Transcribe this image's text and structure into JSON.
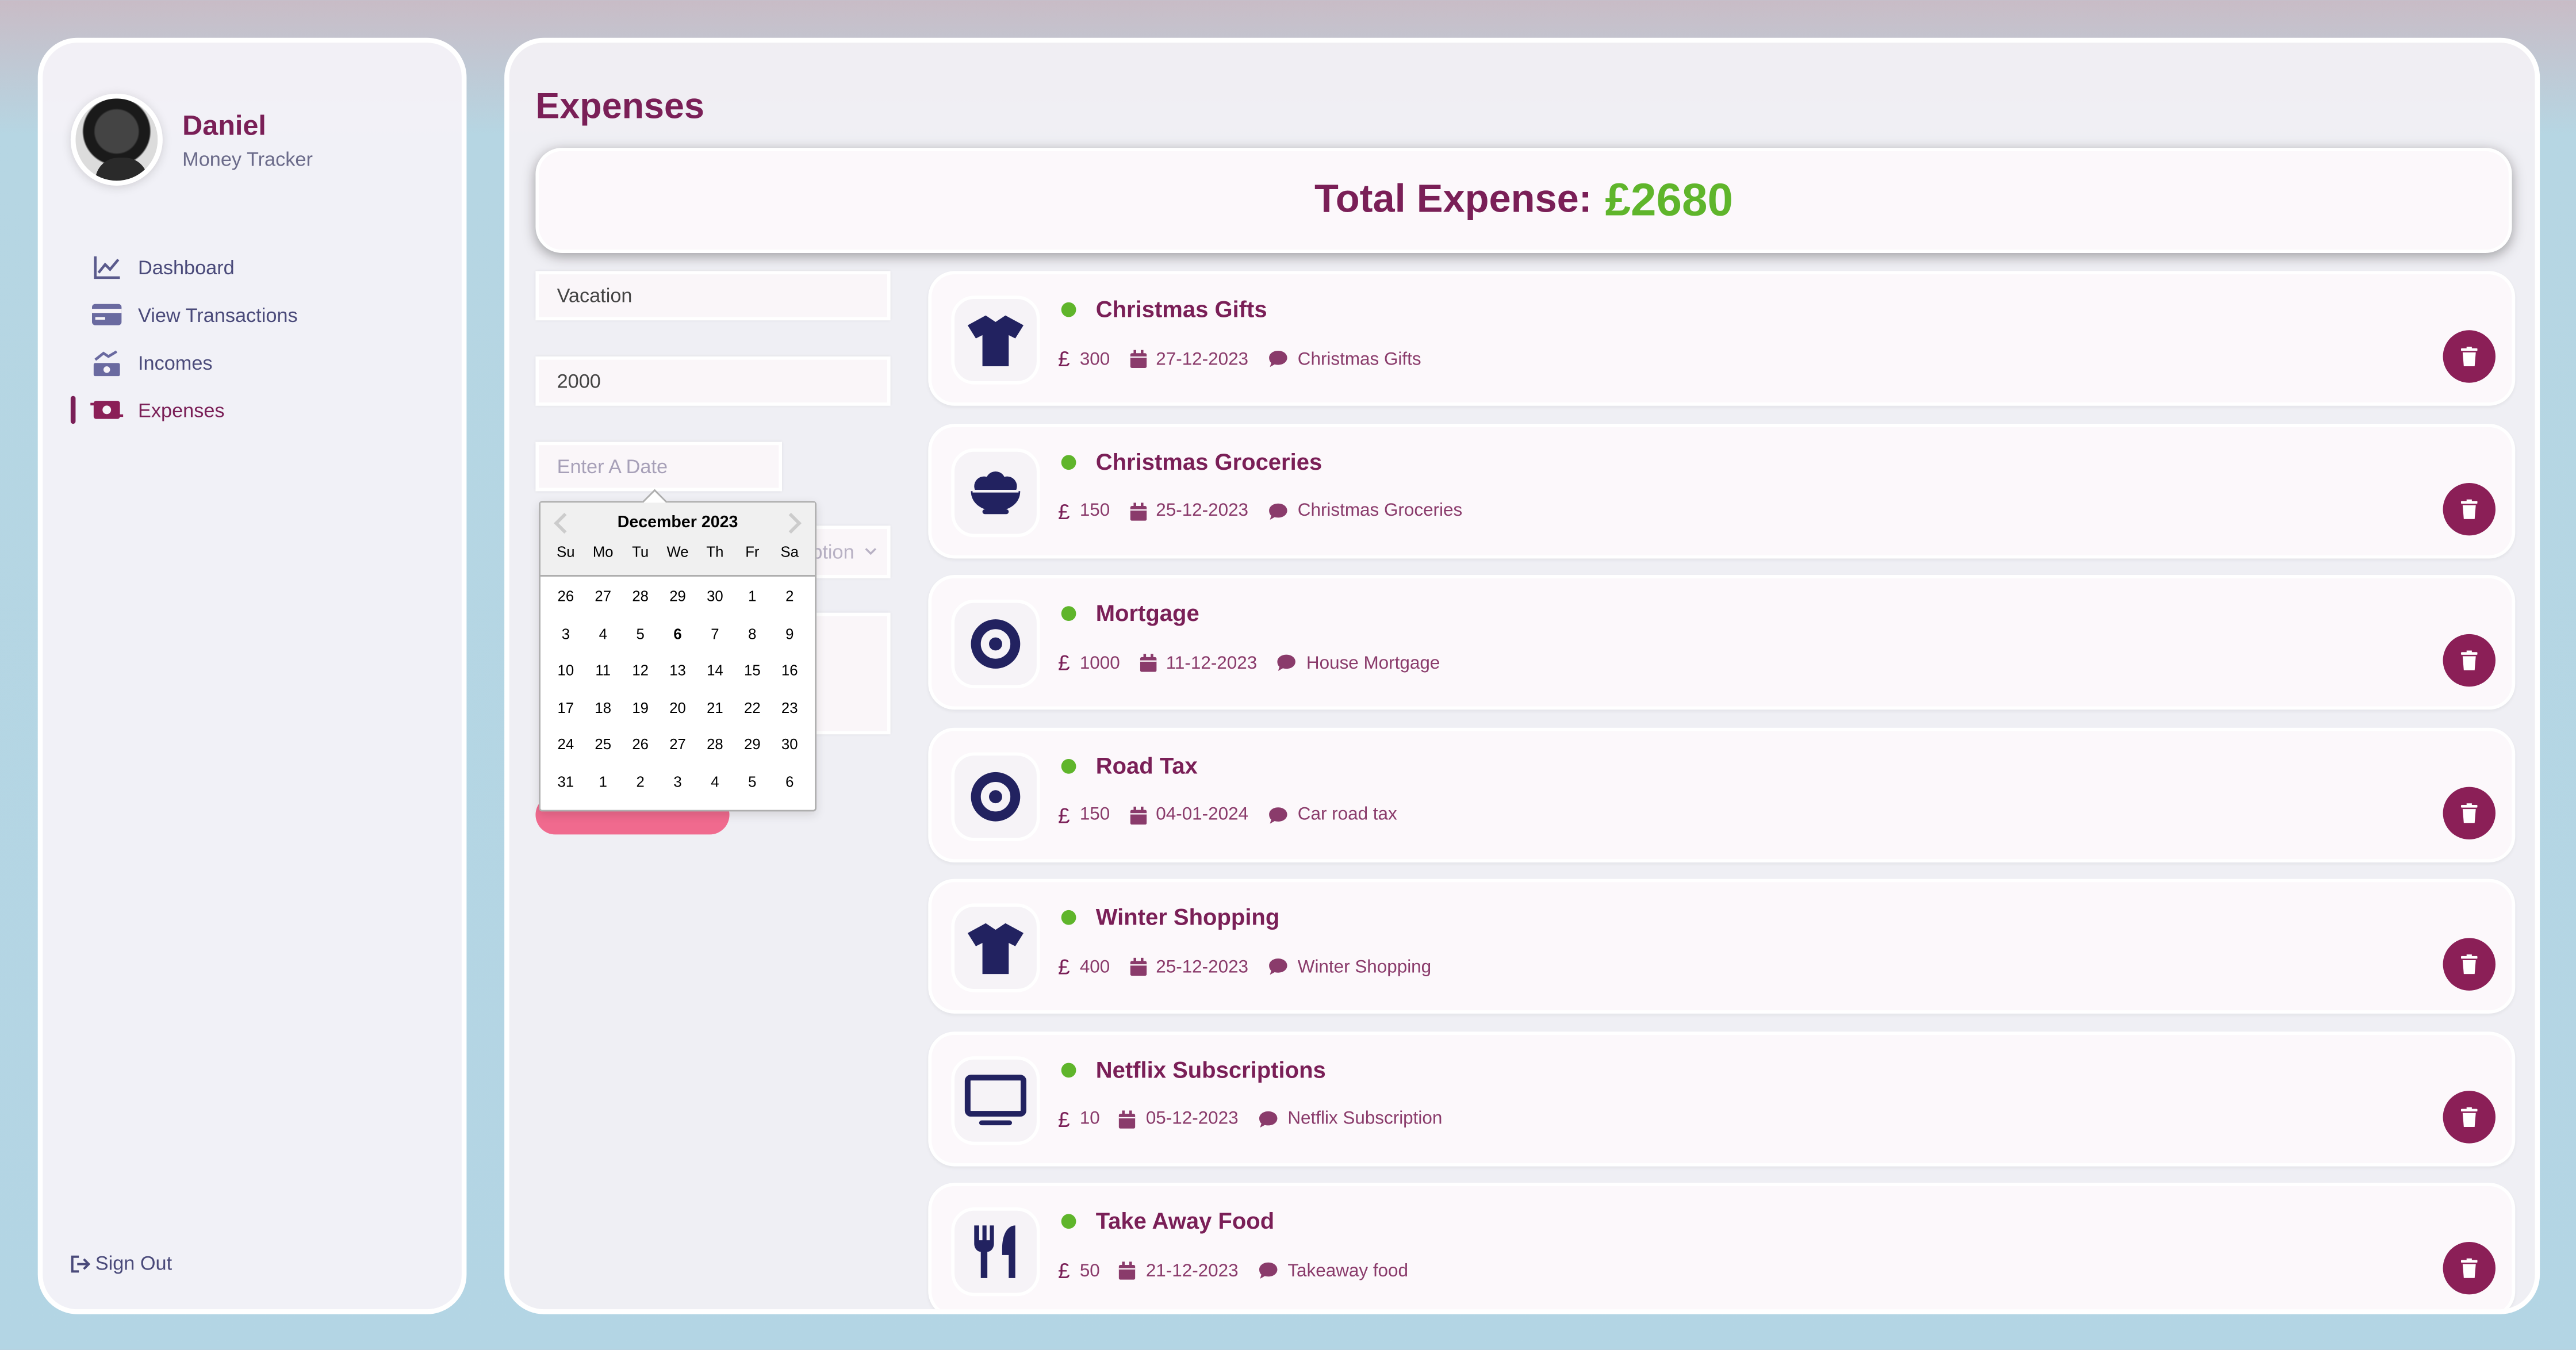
{
  "profile": {
    "name": "Daniel",
    "role": "Money Tracker"
  },
  "nav": [
    {
      "label": "Dashboard",
      "icon": "chart-line-icon"
    },
    {
      "label": "View Transactions",
      "icon": "credit-card-icon"
    },
    {
      "label": "Incomes",
      "icon": "money-bill-trend-up-icon"
    },
    {
      "label": "Expenses",
      "icon": "money-bill-transfer-icon",
      "active": true
    }
  ],
  "signout_label": "Sign Out",
  "page_title": "Expenses",
  "total": {
    "label": "Total Expense:",
    "value": "£2680"
  },
  "form": {
    "title_value": "Vacation",
    "amount_value": "2000",
    "date_placeholder": "Enter A Date",
    "select_visible": "ption"
  },
  "calendar": {
    "month_label": "December 2023",
    "weekdays": [
      "Su",
      "Mo",
      "Tu",
      "We",
      "Th",
      "Fr",
      "Sa"
    ],
    "days": [
      "26",
      "27",
      "28",
      "29",
      "30",
      "1",
      "2",
      "3",
      "4",
      "5",
      "6",
      "7",
      "8",
      "9",
      "10",
      "11",
      "12",
      "13",
      "14",
      "15",
      "16",
      "17",
      "18",
      "19",
      "20",
      "21",
      "22",
      "23",
      "24",
      "25",
      "26",
      "27",
      "28",
      "29",
      "30",
      "31",
      "1",
      "2",
      "3",
      "4",
      "5",
      "6"
    ],
    "today": "6"
  },
  "currency_symbol": "£",
  "expenses": [
    {
      "title": "Christmas Gifts",
      "amount": "300",
      "date": "27-12-2023",
      "description": "Christmas Gifts",
      "icon": "shirt-icon"
    },
    {
      "title": "Christmas Groceries",
      "amount": "150",
      "date": "25-12-2023",
      "description": "Christmas Groceries",
      "icon": "bowl-food-icon"
    },
    {
      "title": "Mortgage",
      "amount": "1000",
      "date": "11-12-2023",
      "description": "House Mortgage",
      "icon": "circle-dot-icon"
    },
    {
      "title": "Road Tax",
      "amount": "150",
      "date": "04-01-2024",
      "description": "Car road tax",
      "icon": "circle-dot-icon"
    },
    {
      "title": "Winter Shopping",
      "amount": "400",
      "date": "25-12-2023",
      "description": "Winter Shopping",
      "icon": "shirt-icon"
    },
    {
      "title": "Netflix Subscriptions",
      "amount": "10",
      "date": "05-12-2023",
      "description": "Netflix Subscription",
      "icon": "tv-icon"
    },
    {
      "title": "Take Away Food",
      "amount": "50",
      "date": "21-12-2023",
      "description": "Takeaway food",
      "icon": "utensils-icon"
    }
  ],
  "colors": {
    "accent": "#7a1f57",
    "success": "#5fb52b",
    "navy": "#222260",
    "button": "#f06a8e"
  }
}
